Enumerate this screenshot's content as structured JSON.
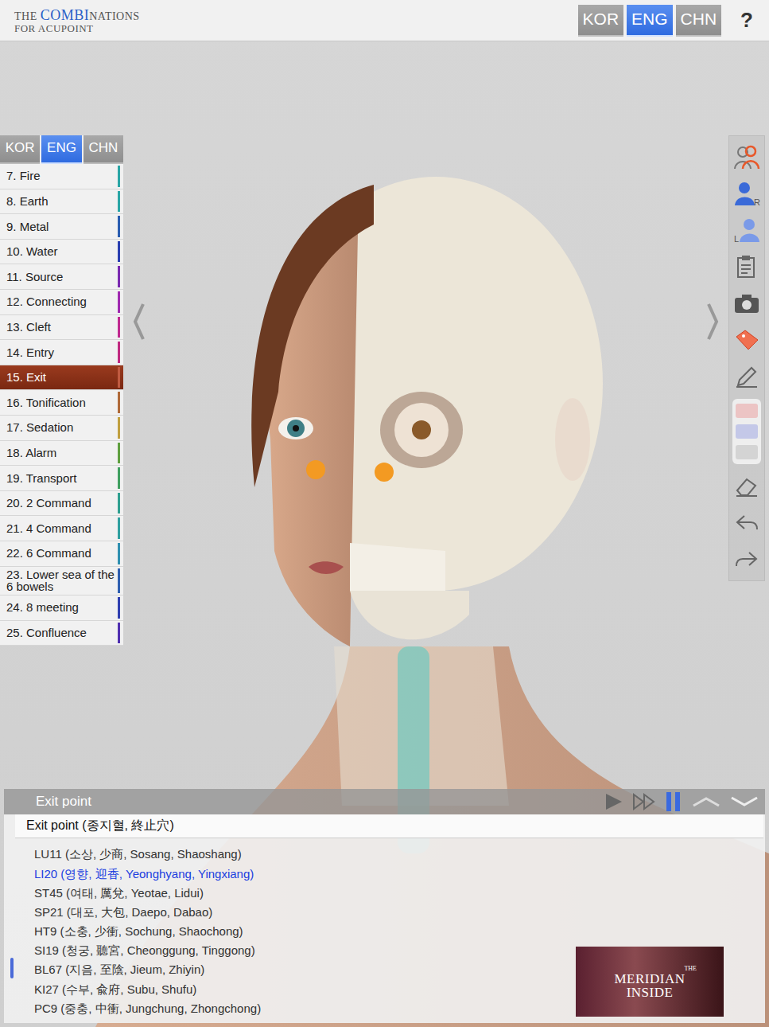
{
  "header": {
    "logo": {
      "first": "THE ",
      "highlight": "COMBI",
      "rest": "NATIONS",
      "line2": "FOR ACUPOINT"
    },
    "languages": [
      {
        "label": "KOR",
        "selected": false
      },
      {
        "label": "ENG",
        "selected": true
      },
      {
        "label": "CHN",
        "selected": false
      }
    ],
    "help": "?"
  },
  "sidebar": {
    "languages": [
      {
        "label": "KOR",
        "selected": false
      },
      {
        "label": "ENG",
        "selected": true
      },
      {
        "label": "CHN",
        "selected": false
      }
    ],
    "items": [
      {
        "label": "7. Fire",
        "selected": false,
        "color": "#2aa6a6"
      },
      {
        "label": "8. Earth",
        "selected": false,
        "color": "#2aa6a6"
      },
      {
        "label": "9. Metal",
        "selected": false,
        "color": "#2a5db0"
      },
      {
        "label": "10. Water",
        "selected": false,
        "color": "#2a3fb0"
      },
      {
        "label": "11. Source",
        "selected": false,
        "color": "#7a2ab0"
      },
      {
        "label": "12. Connecting",
        "selected": false,
        "color": "#a02ab0"
      },
      {
        "label": "13. Cleft",
        "selected": false,
        "color": "#c02a90"
      },
      {
        "label": "14. Entry",
        "selected": false,
        "color": "#c02a80"
      },
      {
        "label": "15. Exit",
        "selected": true,
        "color": "#c05a40"
      },
      {
        "label": "16. Tonification",
        "selected": false,
        "color": "#b06a3a"
      },
      {
        "label": "17. Sedation",
        "selected": false,
        "color": "#c0a040"
      },
      {
        "label": "18. Alarm",
        "selected": false,
        "color": "#60a040"
      },
      {
        "label": "19. Transport",
        "selected": false,
        "color": "#40a060"
      },
      {
        "label": "20. 2 Command",
        "selected": false,
        "color": "#30a090"
      },
      {
        "label": "21. 4 Command",
        "selected": false,
        "color": "#30a0a0"
      },
      {
        "label": "22. 6 Command",
        "selected": false,
        "color": "#3090b0"
      },
      {
        "label": "23. Lower sea of the 6 bowels",
        "selected": false,
        "color": "#3060b0"
      },
      {
        "label": "24. 8 meeting",
        "selected": false,
        "color": "#3040b0"
      },
      {
        "label": "25. Confluence",
        "selected": false,
        "color": "#5030b0"
      }
    ]
  },
  "swatches": [
    {
      "color": "#ecc4c4"
    },
    {
      "color": "#c4c8e8"
    },
    {
      "color": "#d4d4d4"
    }
  ],
  "panel": {
    "title": "Exit point",
    "heading": "Exit point (종지혈, 終止穴)",
    "points": [
      {
        "label": "LU11 (소상, 少商, Sosang, Shaoshang)",
        "selected": false
      },
      {
        "label": "LI20 (영향, 迎香, Yeonghyang, Yingxiang)",
        "selected": true
      },
      {
        "label": "ST45 (여태, 厲兌, Yeotae, Lidui)",
        "selected": false
      },
      {
        "label": "SP21 (대포, 大包, Daepo, Dabao)",
        "selected": false
      },
      {
        "label": "HT9 (소충, 少衝, Sochung, Shaochong)",
        "selected": false
      },
      {
        "label": "SI19 (청궁, 聽宮, Cheonggung, Tinggong)",
        "selected": false
      },
      {
        "label": "BL67 (지음, 至陰, Jieum, Zhiyin)",
        "selected": false
      },
      {
        "label": "KI27 (수부, 兪府, Subu, Shufu)",
        "selected": false
      },
      {
        "label": "PC9 (중충, 中衝, Jungchung, Zhongchong)",
        "selected": false
      }
    ],
    "ad": {
      "small": "THE",
      "line1": "MERIDIAN",
      "line2": "INSIDE"
    }
  }
}
